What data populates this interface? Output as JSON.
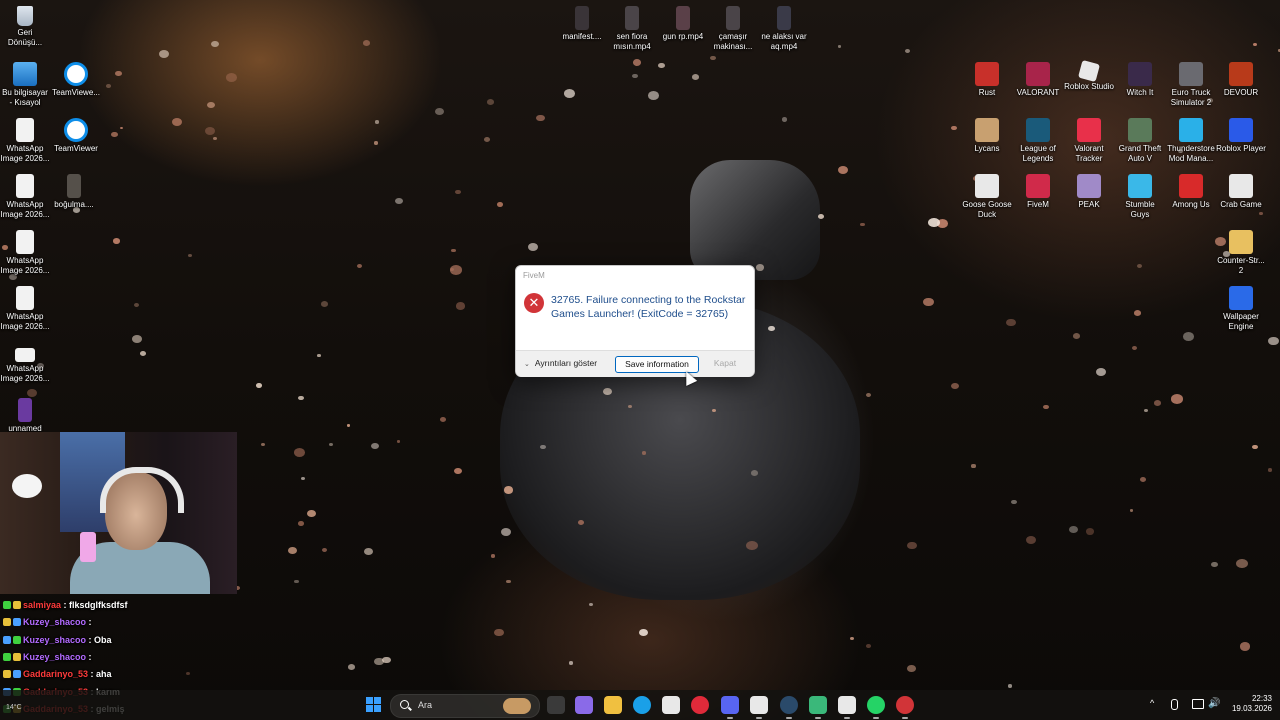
{
  "dialog": {
    "title": "FiveM",
    "error_icon": "error-x-icon",
    "message": "32765. Failure connecting to the Rockstar Games Launcher! (ExitCode = 32765)",
    "details_label": "Ayrıntıları göster",
    "save_label": "Save information",
    "close_label": "Kapat"
  },
  "desktop_left": [
    {
      "label": "Geri Dönüşü..."
    },
    {
      "label": "Bu bilgisayar - Kısayol"
    },
    {
      "label": "TeamViewe..."
    },
    {
      "label": "WhatsApp Image 2026..."
    },
    {
      "label": "TeamViewer"
    },
    {
      "label": "WhatsApp Image 2026..."
    },
    {
      "label": "boğulma...."
    },
    {
      "label": "WhatsApp Image 2026..."
    },
    {
      "label": "WhatsApp Image 2026..."
    },
    {
      "label": "WhatsApp Image 2026..."
    },
    {
      "label": "unnamed"
    }
  ],
  "desktop_top": [
    {
      "label": "manifest...."
    },
    {
      "label": "sen fiora mısın.mp4"
    },
    {
      "label": "gun rp.mp4"
    },
    {
      "label": "çamaşır makinası..."
    },
    {
      "label": "ne alaksı var aq.mp4"
    }
  ],
  "desktop_right": [
    {
      "label": "Rust"
    },
    {
      "label": "VALORANT"
    },
    {
      "label": "Roblox Studio"
    },
    {
      "label": "Witch It"
    },
    {
      "label": "Euro Truck Simulator 2"
    },
    {
      "label": "DEVOUR"
    },
    {
      "label": "Lycans"
    },
    {
      "label": "League of Legends"
    },
    {
      "label": "Valorant Tracker"
    },
    {
      "label": "Grand Theft Auto V"
    },
    {
      "label": "Thunderstore Mod Mana..."
    },
    {
      "label": "Roblox Player"
    },
    {
      "label": "Goose Goose Duck"
    },
    {
      "label": "FiveM"
    },
    {
      "label": "PEAK"
    },
    {
      "label": "Stumble Guys"
    },
    {
      "label": "Among Us"
    },
    {
      "label": "Crab Game"
    },
    {
      "label": "Counter-Str... 2"
    },
    {
      "label": "Wallpaper Engine"
    }
  ],
  "chat": [
    {
      "user": "salmiyaa",
      "message": "flksdglfksdfsf",
      "color": "#ff3b3b"
    },
    {
      "user": "Kuzey_shacoo",
      "message": "",
      "color": "#b36bff"
    },
    {
      "user": "Kuzey_shacoo",
      "message": "Oba",
      "color": "#b36bff"
    },
    {
      "user": "Kuzey_shacoo",
      "message": "",
      "color": "#b36bff"
    },
    {
      "user": "Gaddarinyo_53",
      "message": "aha",
      "color": "#ff3b3b"
    },
    {
      "user": "Gaddarinyo_53",
      "message": "karım",
      "color": "#ff3b3b"
    },
    {
      "user": "Gaddarinyo_53",
      "message": "gelmiş",
      "color": "#ff3b3b"
    }
  ],
  "chat_separator": " : ",
  "taskbar": {
    "search_placeholder": "Ara",
    "apps": [
      "file-manager",
      "copilot",
      "file-explorer",
      "edge",
      "store",
      "opera-gx",
      "discord",
      "capcut",
      "steam",
      "notepad",
      "xbox",
      "whatsapp",
      "fivem-error"
    ],
    "tray": {
      "expand": "^",
      "time": "22:33",
      "date": "19.03.2026"
    },
    "weather_text": "14°C",
    "accent": "#3aa0ff"
  },
  "colors": {
    "dialog_message": "#1f4e8c",
    "error_red": "#d13438",
    "button_border": "#0067c0"
  }
}
